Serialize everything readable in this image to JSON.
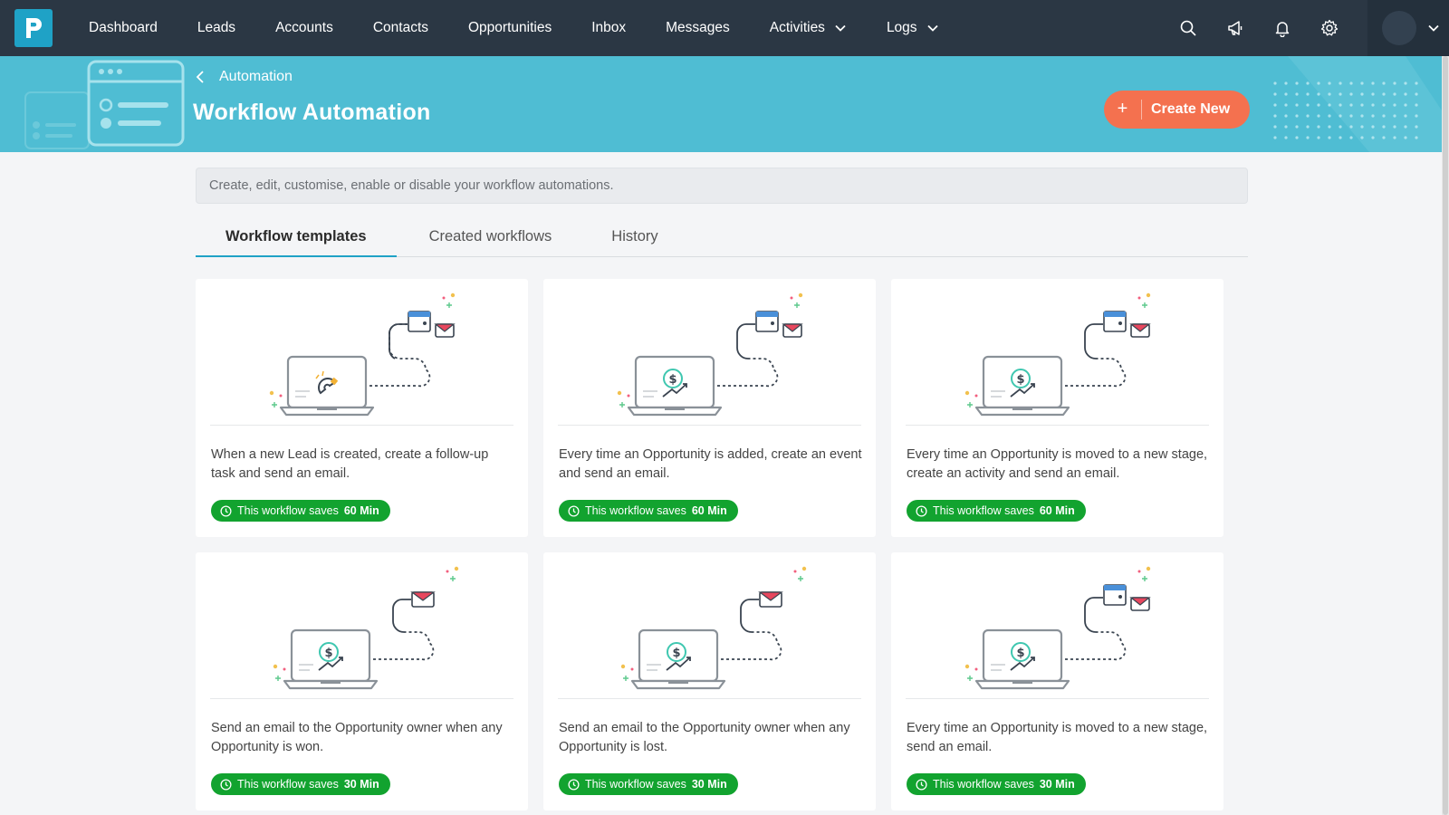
{
  "nav": {
    "items": [
      {
        "label": "Dashboard"
      },
      {
        "label": "Leads"
      },
      {
        "label": "Accounts"
      },
      {
        "label": "Contacts"
      },
      {
        "label": "Opportunities"
      },
      {
        "label": "Inbox"
      },
      {
        "label": "Messages"
      },
      {
        "label": "Activities",
        "dropdown": true
      },
      {
        "label": "Logs",
        "dropdown": true
      }
    ],
    "icons": [
      "search-icon",
      "megaphone-icon",
      "bell-icon",
      "gear-icon"
    ]
  },
  "header": {
    "breadcrumb": "Automation",
    "title": "Workflow Automation",
    "create_button": {
      "plus": "+",
      "label": "Create New"
    }
  },
  "description": "Create, edit, customise, enable or disable your workflow automations.",
  "tabs": [
    {
      "label": "Workflow templates",
      "active": true
    },
    {
      "label": "Created workflows",
      "active": false
    },
    {
      "label": "History",
      "active": false
    }
  ],
  "cards": [
    {
      "illustration": "magnet-calendar-email",
      "text": "When a new Lead is created, create a follow-up task and send an email.",
      "saves_prefix": "This workflow saves",
      "saves_value": "60 Min"
    },
    {
      "illustration": "dollar-calendar-email",
      "text": "Every time an Opportunity is added, create an event and send an email.",
      "saves_prefix": "This workflow saves",
      "saves_value": "60 Min"
    },
    {
      "illustration": "dollar-calendar-email",
      "text": "Every time an Opportunity is moved to a new stage, create an activity and send an email.",
      "saves_prefix": "This workflow saves",
      "saves_value": "60 Min"
    },
    {
      "illustration": "dollar-email",
      "text": "Send an email to the Opportunity owner when any Opportunity is won.",
      "saves_prefix": "This workflow saves",
      "saves_value": "30 Min"
    },
    {
      "illustration": "dollar-email",
      "text": "Send an email to the Opportunity owner when any Opportunity is lost.",
      "saves_prefix": "This workflow saves",
      "saves_value": "30 Min"
    },
    {
      "illustration": "dollar-calendar-email",
      "text": "Every time an Opportunity is moved to a new stage, send an email.",
      "saves_prefix": "This workflow saves",
      "saves_value": "30 Min"
    }
  ],
  "colors": {
    "nav_bg": "#2b3744",
    "banner_bg": "#4fbdd3",
    "accent": "#1fa2c6",
    "create_button": "#f4714f",
    "badge_green": "#12a32f"
  }
}
